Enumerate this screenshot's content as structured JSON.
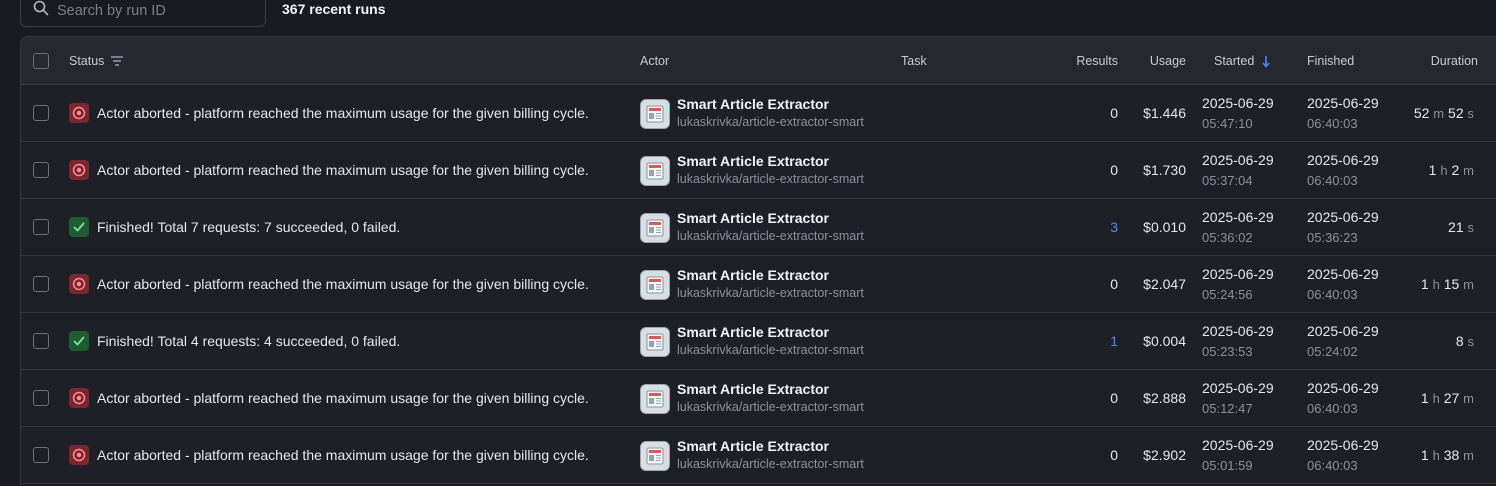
{
  "search": {
    "placeholder": "Search by run ID"
  },
  "run_count": "367 recent runs",
  "columns": {
    "status": "Status",
    "actor": "Actor",
    "task": "Task",
    "results": "Results",
    "usage": "Usage",
    "started": "Started",
    "finished": "Finished",
    "duration": "Duration"
  },
  "colors": {
    "accent_blue": "#4b8bf5",
    "aborted": "#e0525e",
    "success": "#3fbf6a"
  },
  "rows": [
    {
      "status": "aborted",
      "status_text": "Actor aborted - platform reached the maximum usage for the given billing cycle.",
      "actor_name": "Smart Article Extractor",
      "actor_slug": "lukaskrivka/article-extractor-smart",
      "results": "0",
      "results_link": false,
      "usage": "$1.446",
      "started_date": "2025-06-29",
      "started_time": "05:47:10",
      "finished_date": "2025-06-29",
      "finished_time": "06:40:03",
      "duration": [
        [
          "52",
          "m"
        ],
        [
          "52",
          "s"
        ]
      ]
    },
    {
      "status": "aborted",
      "status_text": "Actor aborted - platform reached the maximum usage for the given billing cycle.",
      "actor_name": "Smart Article Extractor",
      "actor_slug": "lukaskrivka/article-extractor-smart",
      "results": "0",
      "results_link": false,
      "usage": "$1.730",
      "started_date": "2025-06-29",
      "started_time": "05:37:04",
      "finished_date": "2025-06-29",
      "finished_time": "06:40:03",
      "duration": [
        [
          "1",
          "h"
        ],
        [
          "2",
          "m"
        ]
      ]
    },
    {
      "status": "ok",
      "status_text": "Finished! Total 7 requests: 7 succeeded, 0 failed.",
      "actor_name": "Smart Article Extractor",
      "actor_slug": "lukaskrivka/article-extractor-smart",
      "results": "3",
      "results_link": true,
      "usage": "$0.010",
      "started_date": "2025-06-29",
      "started_time": "05:36:02",
      "finished_date": "2025-06-29",
      "finished_time": "05:36:23",
      "duration": [
        [
          "21",
          "s"
        ]
      ]
    },
    {
      "status": "aborted",
      "status_text": "Actor aborted - platform reached the maximum usage for the given billing cycle.",
      "actor_name": "Smart Article Extractor",
      "actor_slug": "lukaskrivka/article-extractor-smart",
      "results": "0",
      "results_link": false,
      "usage": "$2.047",
      "started_date": "2025-06-29",
      "started_time": "05:24:56",
      "finished_date": "2025-06-29",
      "finished_time": "06:40:03",
      "duration": [
        [
          "1",
          "h"
        ],
        [
          "15",
          "m"
        ]
      ]
    },
    {
      "status": "ok",
      "status_text": "Finished! Total 4 requests: 4 succeeded, 0 failed.",
      "actor_name": "Smart Article Extractor",
      "actor_slug": "lukaskrivka/article-extractor-smart",
      "results": "1",
      "results_link": true,
      "usage": "$0.004",
      "started_date": "2025-06-29",
      "started_time": "05:23:53",
      "finished_date": "2025-06-29",
      "finished_time": "05:24:02",
      "duration": [
        [
          "8",
          "s"
        ]
      ]
    },
    {
      "status": "aborted",
      "status_text": "Actor aborted - platform reached the maximum usage for the given billing cycle.",
      "actor_name": "Smart Article Extractor",
      "actor_slug": "lukaskrivka/article-extractor-smart",
      "results": "0",
      "results_link": false,
      "usage": "$2.888",
      "started_date": "2025-06-29",
      "started_time": "05:12:47",
      "finished_date": "2025-06-29",
      "finished_time": "06:40:03",
      "duration": [
        [
          "1",
          "h"
        ],
        [
          "27",
          "m"
        ]
      ]
    },
    {
      "status": "aborted",
      "status_text": "Actor aborted - platform reached the maximum usage for the given billing cycle.",
      "actor_name": "Smart Article Extractor",
      "actor_slug": "lukaskrivka/article-extractor-smart",
      "results": "0",
      "results_link": false,
      "usage": "$2.902",
      "started_date": "2025-06-29",
      "started_time": "05:01:59",
      "finished_date": "2025-06-29",
      "finished_time": "06:40:03",
      "duration": [
        [
          "1",
          "h"
        ],
        [
          "38",
          "m"
        ]
      ]
    }
  ]
}
